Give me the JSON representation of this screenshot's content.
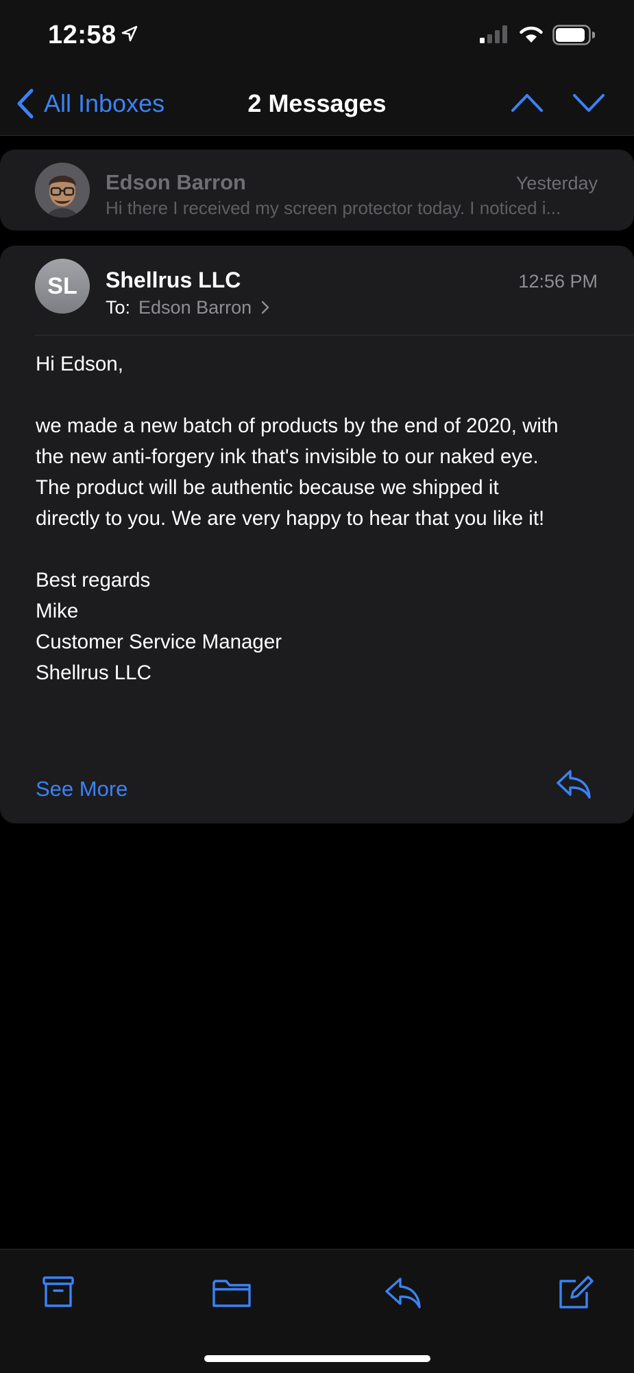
{
  "status_bar": {
    "time": "12:58",
    "icons": [
      "location-arrow-icon",
      "cellular-signal-icon",
      "wifi-icon",
      "battery-icon"
    ]
  },
  "nav": {
    "back_label": "All Inboxes",
    "title": "2 Messages",
    "icons": [
      "chevron-left-icon",
      "chevron-up-icon",
      "chevron-down-icon"
    ]
  },
  "collapsed_message": {
    "sender": "Edson Barron",
    "date": "Yesterday",
    "preview": "Hi there I received my screen protector today. I noticed i..."
  },
  "message": {
    "avatar_initials": "SL",
    "sender": "Shellrus LLC",
    "time": "12:56 PM",
    "to_label": "To:",
    "to_name": "Edson Barron",
    "body": {
      "greeting": "Hi Edson,",
      "paragraph": [
        "we made a new batch of products by the end of 2020, with",
        "the new anti-forgery ink that's invisible to our naked eye.",
        "The product will be authentic because we shipped it",
        "directly to you. We are very happy to hear that you like it!"
      ],
      "signature": [
        "Best regards",
        "Mike",
        "Customer Service Manager",
        "Shellrus LLC"
      ]
    },
    "see_more": "See More"
  },
  "toolbar": {
    "icons": [
      "archive-icon",
      "folder-icon",
      "reply-icon",
      "compose-icon"
    ]
  },
  "colors": {
    "accent": "#3b82f6",
    "background": "#000000",
    "card": "#1c1c1e",
    "bar": "#121212",
    "secondary_text": "#8e8e93"
  }
}
